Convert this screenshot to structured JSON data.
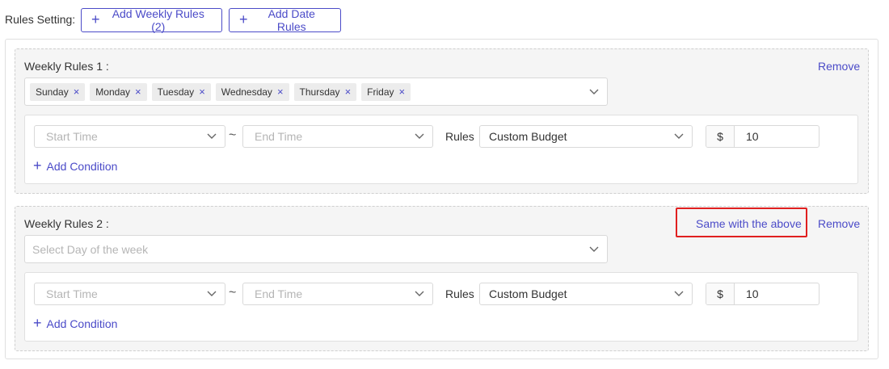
{
  "header": {
    "label": "Rules Setting:",
    "add_weekly_label": "Add Weekly Rules (2)",
    "add_date_label": "Add Date Rules"
  },
  "rules": [
    {
      "title": "Weekly Rules 1 :",
      "remove_label": "Remove",
      "days": [
        "Sunday",
        "Monday",
        "Tuesday",
        "Wednesday",
        "Thursday",
        "Friday"
      ],
      "start_placeholder": "Start Time",
      "end_placeholder": "End Time",
      "tilde": "~",
      "rules_label": "Rules",
      "rule_type": "Custom Budget",
      "currency": "$",
      "amount": "10",
      "add_condition": "Add Condition"
    },
    {
      "title": "Weekly Rules 2 :",
      "remove_label": "Remove",
      "same_label": "Same with the above",
      "day_placeholder": "Select Day of the week",
      "start_placeholder": "Start Time",
      "end_placeholder": "End Time",
      "tilde": "~",
      "rules_label": "Rules",
      "rule_type": "Custom Budget",
      "currency": "$",
      "amount": "10",
      "add_condition": "Add Condition"
    }
  ],
  "colors": {
    "accent": "#4b4bc8",
    "highlight": "#e02020"
  },
  "icons": {
    "plus": "plus-icon",
    "close": "close-icon",
    "chevron": "chevron-down-icon"
  }
}
